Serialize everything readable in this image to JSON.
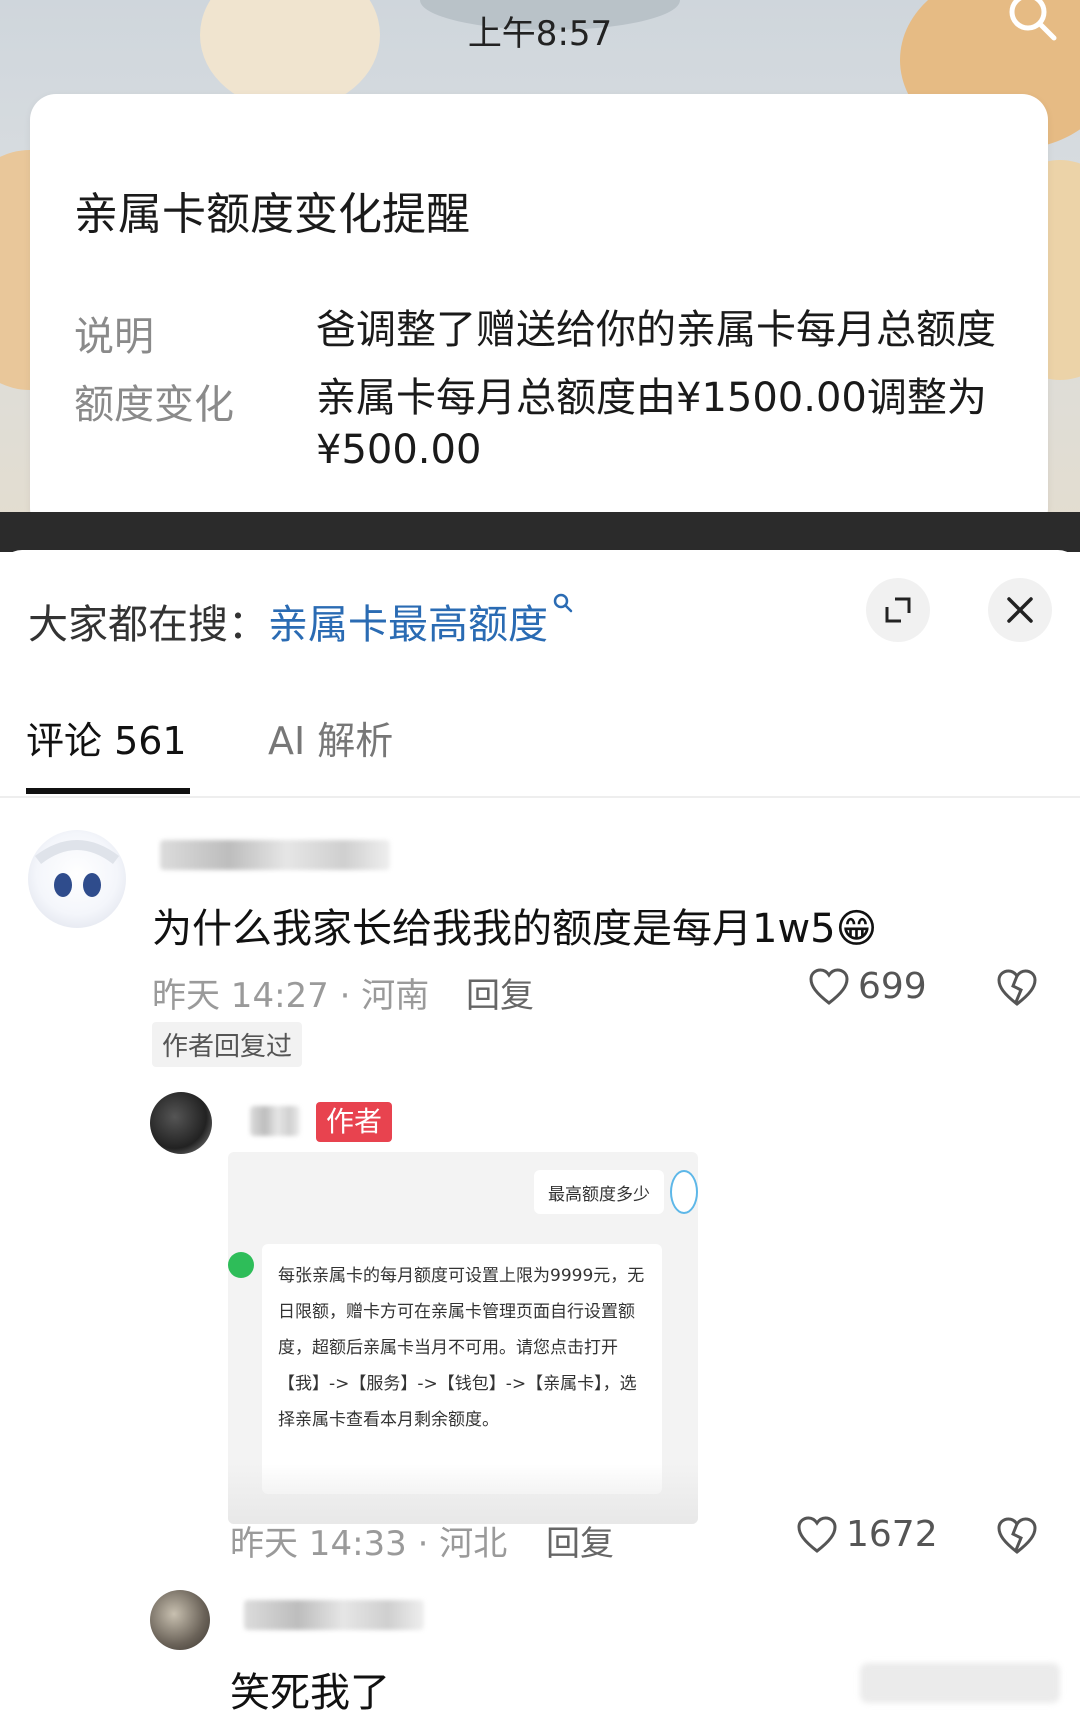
{
  "status_bar": {
    "time": "上午8:57"
  },
  "notification": {
    "title": "亲属卡额度变化提醒",
    "rows": [
      {
        "label": "说明",
        "value": "爸调整了赠送给你的亲属卡每月总额度"
      },
      {
        "label": "额度变化",
        "value": "亲属卡每月总额度由¥1500.00调整为¥500.00"
      }
    ]
  },
  "search_hint": {
    "prefix": "大家都在搜：",
    "query": "亲属卡最高额度"
  },
  "tabs": [
    {
      "label": "评论 561",
      "active": true
    },
    {
      "label": "AI 解析",
      "active": false
    }
  ],
  "comments": [
    {
      "text": "为什么我家长给我我的额度是每月1w5😁",
      "meta": "昨天 14:27 · 河南",
      "reply_label": "回复",
      "likes": "699",
      "tag": "作者回复过"
    },
    {
      "badge": "作者",
      "meta": "昨天 14:33 · 河北",
      "reply_label": "回复",
      "likes": "1672",
      "embed": {
        "question": "最高额度多少",
        "answer": "每张亲属卡的每月额度可设置上限为9999元，无日限额，赠卡方可在亲属卡管理页面自行设置额度，超额后亲属卡当月不可用。请您点击打开【我】->【服务】->【钱包】->【亲属卡】，选择亲属卡查看本月剩余额度。"
      }
    },
    {
      "text": "笑死我了"
    }
  ],
  "colors": {
    "link": "#2a6bb3",
    "author_badge": "#e8434f",
    "text": "#111111",
    "muted": "#9a9a9a"
  }
}
